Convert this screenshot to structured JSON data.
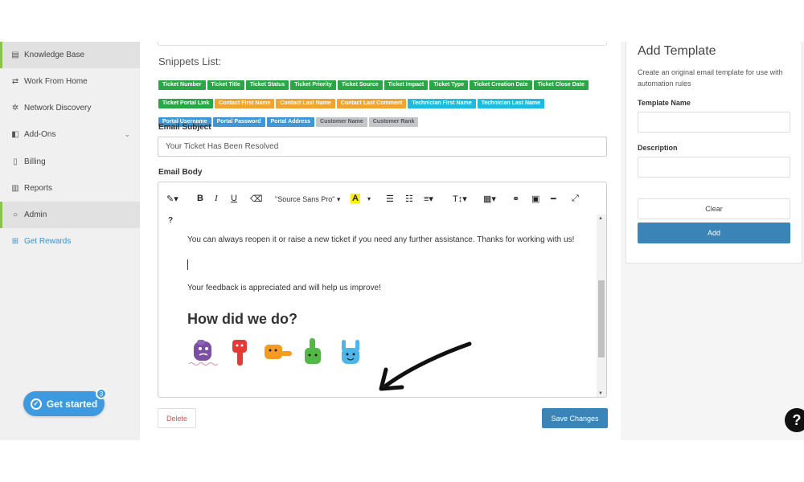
{
  "sidebar": {
    "items": [
      {
        "label": "Knowledge Base",
        "icon": "book-icon",
        "glyph": "▤"
      },
      {
        "label": "Work From Home",
        "icon": "remote-icon",
        "glyph": "⇄"
      },
      {
        "label": "Network Discovery",
        "icon": "network-icon",
        "glyph": "✲"
      },
      {
        "label": "Add-Ons",
        "icon": "puzzle-icon",
        "glyph": "◧"
      },
      {
        "label": "Billing",
        "icon": "invoice-icon",
        "glyph": "▯"
      },
      {
        "label": "Reports",
        "icon": "bar-chart-icon",
        "glyph": "▥"
      },
      {
        "label": "Admin",
        "icon": "circle-icon",
        "glyph": "○"
      },
      {
        "label": "Get Rewards",
        "icon": "gift-icon",
        "glyph": "⊞"
      }
    ],
    "get_started": {
      "label": "Get started",
      "badge": "3"
    }
  },
  "main": {
    "snippets_title": "Snippets List:",
    "snippets": [
      {
        "label": "Ticket Number",
        "color": "green"
      },
      {
        "label": "Ticket Title",
        "color": "green"
      },
      {
        "label": "Ticket Status",
        "color": "green"
      },
      {
        "label": "Ticket Priority",
        "color": "green"
      },
      {
        "label": "Ticket Source",
        "color": "green"
      },
      {
        "label": "Ticket Impact",
        "color": "green"
      },
      {
        "label": "Ticket Type",
        "color": "green"
      },
      {
        "label": "Ticket Creation Date",
        "color": "green"
      },
      {
        "label": "Ticket Close Date",
        "color": "green"
      },
      {
        "label": "Ticket Portal Link",
        "color": "green"
      },
      {
        "label": "Contact First Name",
        "color": "orange"
      },
      {
        "label": "Contact Last Name",
        "color": "orange"
      },
      {
        "label": "Contact Last Comment",
        "color": "orange"
      },
      {
        "label": "Technician First Name",
        "color": "cyan"
      },
      {
        "label": "Technician Last Name",
        "color": "cyan"
      },
      {
        "label": "Portal Username",
        "color": "blue"
      },
      {
        "label": "Portal Password",
        "color": "blue"
      },
      {
        "label": "Portal Address",
        "color": "blue"
      },
      {
        "label": "Customer Name",
        "color": "gray"
      },
      {
        "label": "Customer Rank",
        "color": "gray"
      }
    ],
    "email_subject_label": "Email Subject",
    "email_subject_value": "Your Ticket Has Been Resolved",
    "email_body_label": "Email Body",
    "toolbar": {
      "magic": "✎▾",
      "bold": "B",
      "italic": "I",
      "underline": "U",
      "eraser": "⌫",
      "font": "\"Source Sans Pro\" ▾",
      "highlight": "A",
      "highlight_caret": "▾",
      "ul": "☰",
      "ol": "☷",
      "align": "≡▾",
      "size": "T↕▾",
      "table": "▦▾",
      "link": "⚭",
      "image": "▣",
      "hr": "━",
      "fullscreen": "⤢"
    },
    "body": {
      "qmark": "?",
      "line1": "You can always reopen it or raise a new ticket if you need any further assistance. Thanks for working with us!",
      "line2": "Your feedback is appreciated and will help us improve!",
      "heading": "How did we do?"
    },
    "delete_label": "Delete",
    "save_label": "Save Changes"
  },
  "panel": {
    "title": "Add Template",
    "description": "Create an original email template for use with automation rules",
    "name_label": "Template Name",
    "desc_label": "Description",
    "clear_label": "Clear",
    "add_label": "Add"
  },
  "help": "?",
  "colors": {
    "accent_blue": "#3a84b8",
    "active_green": "#8bc34a",
    "delete_red": "#d9534f"
  }
}
